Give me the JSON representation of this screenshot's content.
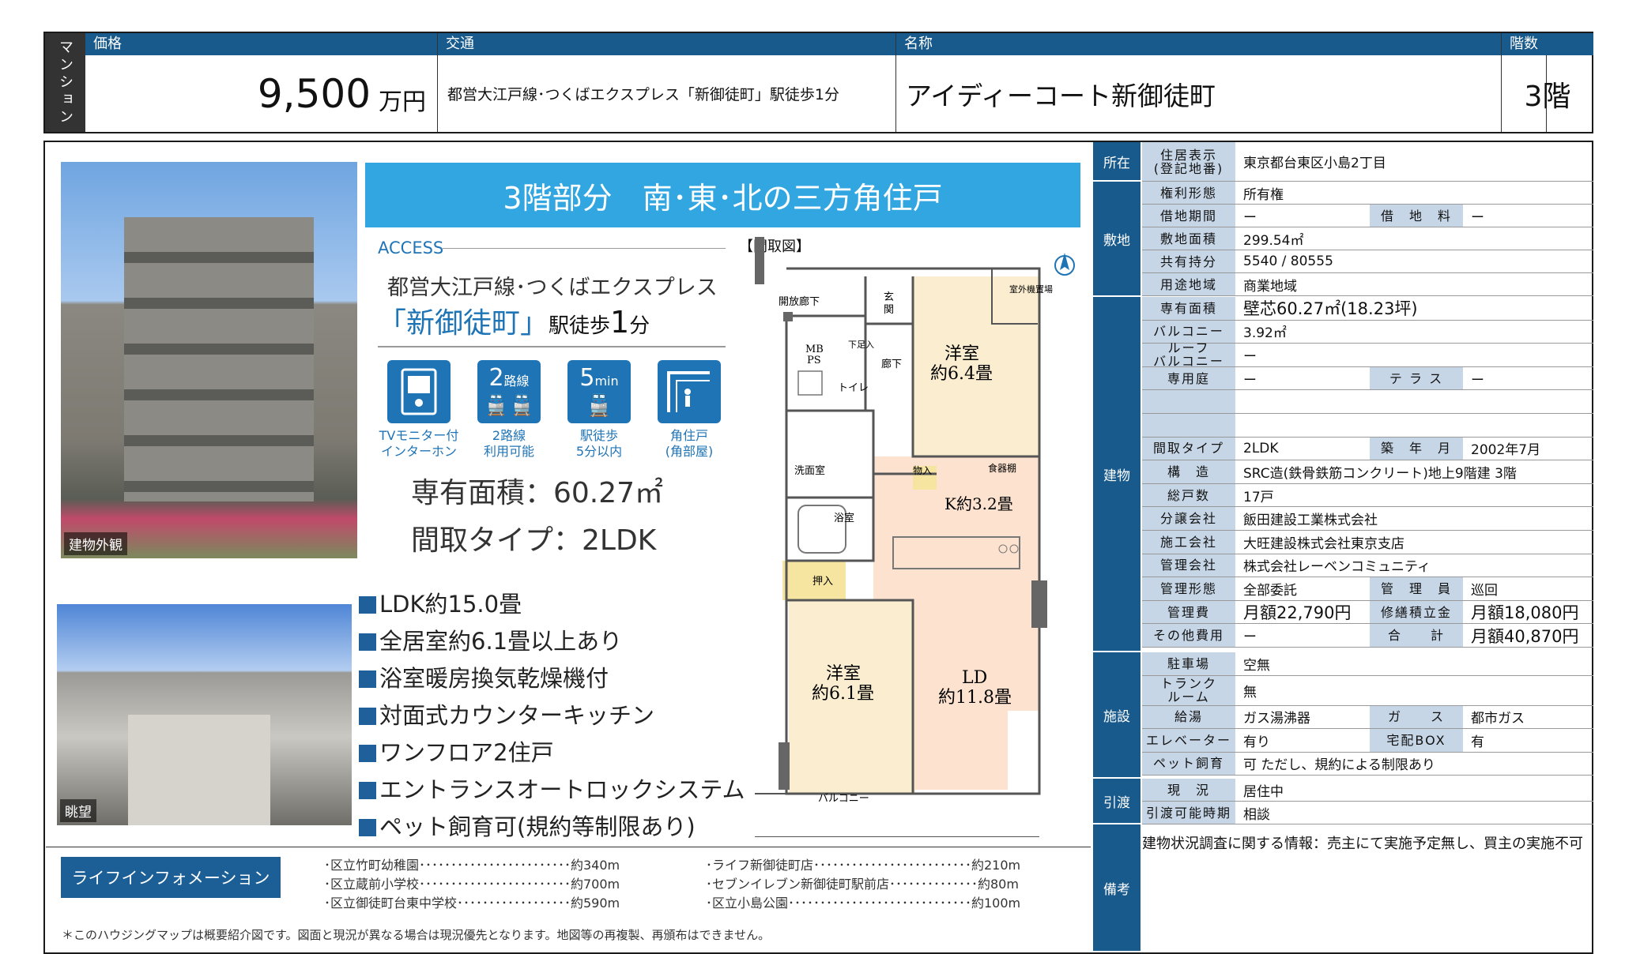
{
  "header": {
    "side": "マンション",
    "price_label": "価格",
    "price_value": "9,500",
    "price_unit": "万円",
    "access_label": "交通",
    "access_value": "都営大江戸線･つくばエクスプレス「新御徒町」駅徒歩1分",
    "name_label": "名称",
    "name_value": "アイディーコート新御徒町",
    "floor_label": "階数",
    "floor_value": "3階"
  },
  "banner": "3階部分　南･東･北の三方角住戸",
  "photos": {
    "exterior": "建物外観",
    "view": "眺望"
  },
  "access": {
    "heading": "ACCESS",
    "line": "都営大江戸線･つくばエクスプレス",
    "station": "「新御徒町」",
    "walk_pre": "駅徒歩",
    "walk_num": "1",
    "walk_unit": "分"
  },
  "icons": [
    {
      "name": "tv-intercom-icon",
      "cap1": "TVモニター付",
      "cap2": "インターホン"
    },
    {
      "name": "two-lines-icon",
      "num": "2",
      "unit": "路線",
      "cap1": "2路線",
      "cap2": "利用可能"
    },
    {
      "name": "five-min-icon",
      "num": "5",
      "unit": "min",
      "cap1": "駅徒歩",
      "cap2": "5分以内"
    },
    {
      "name": "corner-unit-icon",
      "cap1": "角住戸",
      "cap2": "(角部屋)"
    }
  ],
  "area": "専有面積：60.27㎡",
  "layout": "間取タイプ：2LDK",
  "features": [
    "LDK約15.0畳",
    "全居室約6.1畳以上あり",
    "浴室暖房換気乾燥機付",
    "対面式カウンターキッチン",
    "ワンフロア2住戸",
    "エントランスオートロックシステム",
    "ペット飼育可(規約等制限あり)"
  ],
  "floorplan": {
    "title": "【間取図】",
    "rooms": {
      "hall": "開放廊下",
      "entry": "玄\n関",
      "mbps1": "MB",
      "mbps2": "PS",
      "shoes": "下足入",
      "corridor": "廊下",
      "toilet": "トイレ",
      "western1a": "洋室",
      "western1b": "約6.4畳",
      "outdoor": "室外機置場",
      "washroom": "洗面室",
      "bath": "浴室",
      "storage1": "物入",
      "shelf": "食器棚",
      "kitchen": "K約3.2畳",
      "closet": "押入",
      "western2a": "洋室",
      "western2b": "約6.1畳",
      "lda": "LD",
      "ldb": "約11.8畳",
      "balcony": "バルコニー"
    }
  },
  "life": {
    "title": "ライフインフォメーション",
    "left": [
      "･区立竹町幼稚園････････････････････････約340m",
      "･区立蔵前小学校････････････････････････約700m",
      "･区立御徒町台東中学校･･････････････････約590m"
    ],
    "right": [
      "･ライフ新御徒町店･････････････････････････約210m",
      "･セブンイレブン新御徒町駅前店･･････････････約80m",
      "･区立小島公園･････････････････････････････約100m"
    ]
  },
  "note": "＊このハウジングマップは概要紹介図です。図面と現況が異なる場合は現況優先となります。地図等の再複製、再頒布はできません。",
  "table": {
    "categories": {
      "location": "所在",
      "land": "敷地",
      "building": "建物",
      "facility": "施設",
      "delivery": "引渡",
      "remarks": "備考"
    },
    "location": {
      "label": "住居表示\n(登記地番)",
      "value": "東京都台東区小島2丁目"
    },
    "land": [
      {
        "l": "権利形態",
        "v": "所有権"
      },
      {
        "l": "借地期間",
        "v": "ー",
        "l2": "借　地　料",
        "v2": "ー"
      },
      {
        "l": "敷地面積",
        "v": "299.54㎡"
      },
      {
        "l": "共有持分",
        "v": "5540 / 80555"
      },
      {
        "l": "用途地域",
        "v": "商業地域"
      }
    ],
    "building": [
      {
        "l": "専有面積",
        "v": "壁芯60.27㎡(18.23坪)"
      },
      {
        "l": "バルコニー",
        "v": "3.92㎡"
      },
      {
        "l": "ルーフ\nバルコニー",
        "v": "ー"
      },
      {
        "l": "専用庭",
        "v": "ー",
        "l2": "テ ラ ス",
        "v2": "ー"
      },
      {
        "l": "",
        "v": ""
      },
      {
        "l": "",
        "v": ""
      },
      {
        "l": "間取タイプ",
        "v": "2LDK",
        "l2": "築　年　月",
        "v2": "2002年7月"
      },
      {
        "l": "構　造",
        "v": "SRC造(鉄骨鉄筋コンクリート)地上9階建 3階"
      },
      {
        "l": "総戸数",
        "v": "17戸"
      },
      {
        "l": "分譲会社",
        "v": "飯田建設工業株式会社"
      },
      {
        "l": "施工会社",
        "v": "大旺建設株式会社東京支店"
      },
      {
        "l": "管理会社",
        "v": "株式会社レーベンコミュニティ"
      },
      {
        "l": "管理形態",
        "v": "全部委託",
        "l2": "管　理　員",
        "v2": "巡回"
      },
      {
        "l": "管理費",
        "v": "月額22,790円",
        "l2": "修繕積立金",
        "v2": "月額18,080円"
      },
      {
        "l": "その他費用",
        "v": "ー",
        "l2": "合　　計",
        "v2": "月額40,870円"
      }
    ],
    "facility": [
      {
        "l": "駐車場",
        "v": "空無"
      },
      {
        "l": "トランク\nルーム",
        "v": "無"
      },
      {
        "l": "給湯",
        "v": "ガス湯沸器",
        "l2": "ガ　　ス",
        "v2": "都市ガス"
      },
      {
        "l": "エレベーター",
        "v": "有り",
        "l2": "宅配BOX",
        "v2": "有"
      },
      {
        "l": "ペット飼育",
        "v": "可 ただし、規約による制限あり"
      }
    ],
    "delivery": [
      {
        "l": "現　況",
        "v": "居住中"
      },
      {
        "l": "引渡可能時期",
        "v": "相談"
      }
    ],
    "remarks": "建物状況調査に関する情報：売主にて実施予定無し、買主の実施不可"
  }
}
